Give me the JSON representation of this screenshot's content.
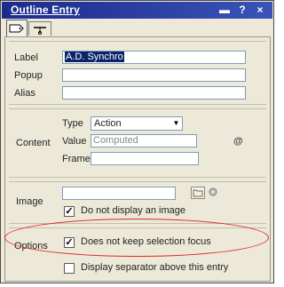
{
  "window": {
    "title": "Outline Entry",
    "menu_glyph": "▬",
    "help_glyph": "?",
    "close_glyph": "×"
  },
  "tabs": [
    {
      "name": "basics",
      "icon": "tag-icon",
      "active": true
    },
    {
      "name": "advanced",
      "icon": "propeller-icon",
      "active": false
    }
  ],
  "basics": {
    "label_caption": "Label",
    "label_value": "A.D. Synchro",
    "popup_caption": "Popup",
    "popup_value": "",
    "alias_caption": "Alias",
    "alias_value": ""
  },
  "content": {
    "group_caption": "Content",
    "type_caption": "Type",
    "type_value": "Action",
    "value_caption": "Value",
    "value_placeholder": "Computed",
    "value_symbol": "@",
    "frame_caption": "Frame",
    "frame_value": ""
  },
  "image": {
    "group_caption": "Image",
    "image_value": "",
    "no_image_label": "Do not display an image",
    "no_image_checked": true
  },
  "options": {
    "group_caption": "Options",
    "focus_label": "Does not keep selection focus",
    "focus_checked": true,
    "separator_label": "Display separator above this entry",
    "separator_checked": false
  },
  "colors": {
    "title_bar": "#1c2a8c",
    "dialog_bg": "#ece9d8",
    "highlight_ellipse": "#e0262b",
    "selection": "#0a246a"
  }
}
